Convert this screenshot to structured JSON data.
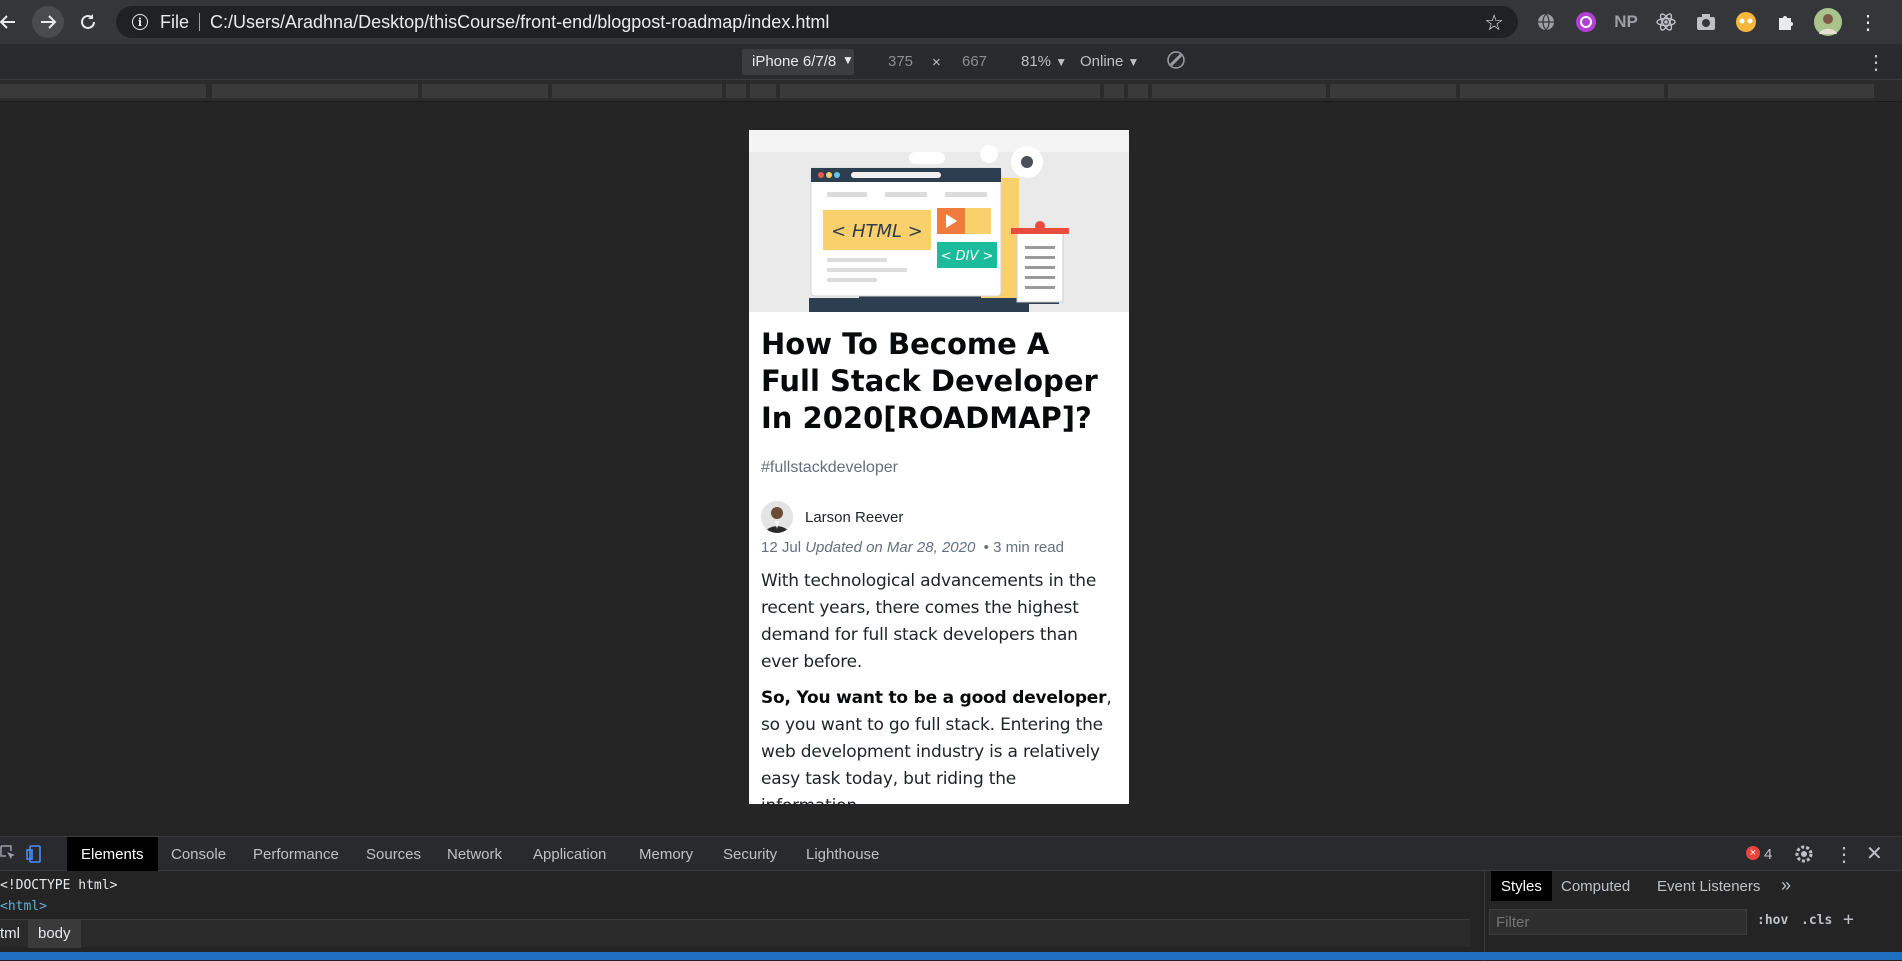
{
  "browser": {
    "url_scheme": "File",
    "url": "C:/Users/Aradhna/Desktop/thisCourse/front-end/blogpost-roadmap/index.html",
    "extensions": [
      "globe-icon",
      "tracker-icon",
      "NP",
      "react-icon",
      "camera-icon",
      "cookie-icon",
      "puzzle-icon",
      "profile-avatar"
    ]
  },
  "device_toolbar": {
    "device": "iPhone 6/7/8",
    "width": "375",
    "times": "×",
    "height": "667",
    "zoom": "81%",
    "network": "Online"
  },
  "article": {
    "title": "How To Become A Full Stack Developer In 2020[ROADMAP]?",
    "tag": "#fullstackdeveloper",
    "author": "Larson Reever",
    "date": "12 Jul",
    "updated": "Updated on Mar 28, 2020",
    "read_time": "• 3 min read",
    "para1": "With technological advancements in the recent years, there comes the highest demand for full stack developers than ever before.",
    "para2_bold": "So, You want to be a good developer",
    "para2_rest": ", so you want to go full stack. Entering the web development industry is a relatively easy task today, but riding the information",
    "hero": {
      "html_label": "< HTML >",
      "div_label": "< DIV >"
    }
  },
  "devtools": {
    "tabs": [
      "Elements",
      "Console",
      "Performance",
      "Sources",
      "Network",
      "Application",
      "Memory",
      "Security",
      "Lighthouse"
    ],
    "error_count": "4",
    "dom_lines": [
      "<!DOCTYPE html>",
      "<html>"
    ],
    "breadcrumbs": [
      "tml",
      "body"
    ],
    "styles_tabs": [
      "Styles",
      "Computed",
      "Event Listeners"
    ],
    "filter_placeholder": "Filter",
    "hov": ":hov",
    "cls": ".cls"
  },
  "colors": {
    "accent": "#1e6fbf",
    "hero_yellow": "#f9d06b",
    "hero_teal": "#1abc9c",
    "hero_orange": "#f07b3f"
  }
}
